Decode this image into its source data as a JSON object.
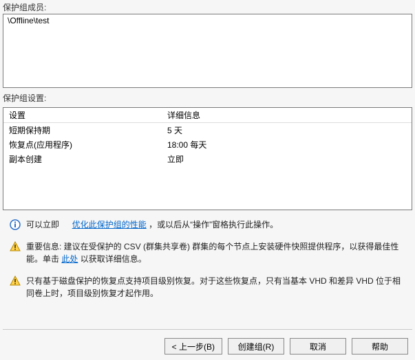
{
  "members": {
    "label": "保护组成员:",
    "content": "\\Offline\\test"
  },
  "settings": {
    "label": "保护组设置:",
    "headers": {
      "setting": "设置",
      "detail": "详细信息"
    },
    "rows": [
      {
        "setting": "短期保持期",
        "detail": "5 天"
      },
      {
        "setting": "恢复点(应用程序)",
        "detail": "18:00 每天"
      },
      {
        "setting": "副本创建",
        "detail": "立即"
      }
    ]
  },
  "notes": {
    "info": {
      "prefix": "可以立即",
      "link": "优化此保护组的性能",
      "suffix": "，或以后从“操作”窗格执行此操作。"
    },
    "warn1": {
      "prefix": "重要信息:    建议在受保护的 CSV (群集共享卷) 群集的每个节点上安装硬件快照提供程序，以获得最佳性能。单击 ",
      "link": "此处",
      "suffix": " 以获取详细信息。"
    },
    "warn2": {
      "text": "只有基于磁盘保护的恢复点支持项目级别恢复。对于这些恢复点，只有当基本 VHD 和差异 VHD 位于相同卷上时，项目级别恢复才起作用。"
    }
  },
  "buttons": {
    "back": "< 上一步(B)",
    "create": "创建组(R)",
    "cancel": "取消",
    "help": "帮助"
  }
}
